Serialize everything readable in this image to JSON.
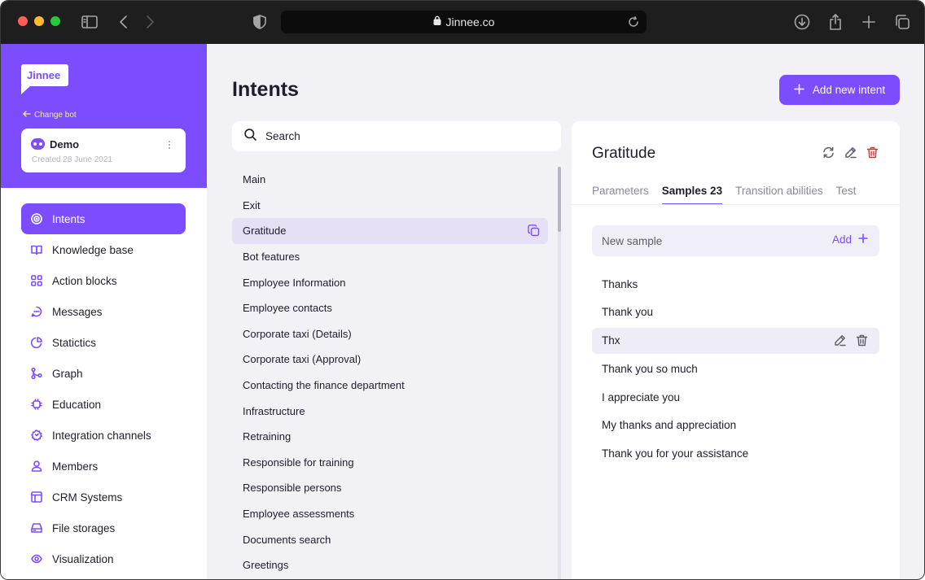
{
  "browser": {
    "url": "Jinnee.co",
    "icons": [
      "sidebar-toggle-icon",
      "back-icon",
      "forward-icon",
      "shield-icon",
      "lock-icon",
      "reload-icon",
      "download-icon",
      "share-icon",
      "new-tab-icon",
      "tabs-overview-icon"
    ]
  },
  "sidebar": {
    "logo_text": "Jinnee",
    "change_bot_label": "Change bot",
    "bot": {
      "name": "Demo",
      "created": "Created 28 June 2021"
    },
    "items": [
      {
        "label": "Intents",
        "icon": "target-icon",
        "active": true
      },
      {
        "label": "Knowledge base",
        "icon": "book-icon"
      },
      {
        "label": "Action blocks",
        "icon": "grid-icon"
      },
      {
        "label": "Messages",
        "icon": "chat-icon"
      },
      {
        "label": "Statictics",
        "icon": "pie-chart-icon"
      },
      {
        "label": "Graph",
        "icon": "graph-icon"
      },
      {
        "label": "Education",
        "icon": "chip-icon"
      },
      {
        "label": "Integration channels",
        "icon": "integration-icon"
      },
      {
        "label": "Members",
        "icon": "user-icon"
      },
      {
        "label": "CRM Systems",
        "icon": "layout-icon"
      },
      {
        "label": "File storages",
        "icon": "storage-icon"
      },
      {
        "label": "Visualization",
        "icon": "eye-icon"
      }
    ]
  },
  "main": {
    "title": "Intents",
    "add_button_label": "Add new intent",
    "search_placeholder": "Search",
    "intents": [
      "Main",
      "Exit",
      "Gratitude",
      "Bot features",
      "Employee Information",
      "Employee contacts",
      "Corporate taxi (Details)",
      "Corporate taxi (Approval)",
      "Contacting the finance department",
      "Infrastructure",
      "Retraining",
      "Responsible for training",
      "Responsible persons",
      "Employee assessments",
      "Documents search",
      "Greetings"
    ],
    "selected_intent_index": 2
  },
  "detail": {
    "title": "Gratitude",
    "tabs": [
      "Parameters",
      "Samples 23",
      "Transition abilities",
      "Test"
    ],
    "active_tab_index": 1,
    "new_sample_placeholder": "New sample",
    "add_label": "Add",
    "samples": [
      "Thanks",
      "Thank you",
      "Thx",
      "Thank you so much",
      "I appreciate you",
      "My thanks and appreciation",
      "Thank you for your assistance"
    ],
    "hovered_sample_index": 2
  },
  "colors": {
    "accent": "#7c4dff",
    "danger": "#e5322d",
    "change_bot": "#f4ef8a"
  }
}
